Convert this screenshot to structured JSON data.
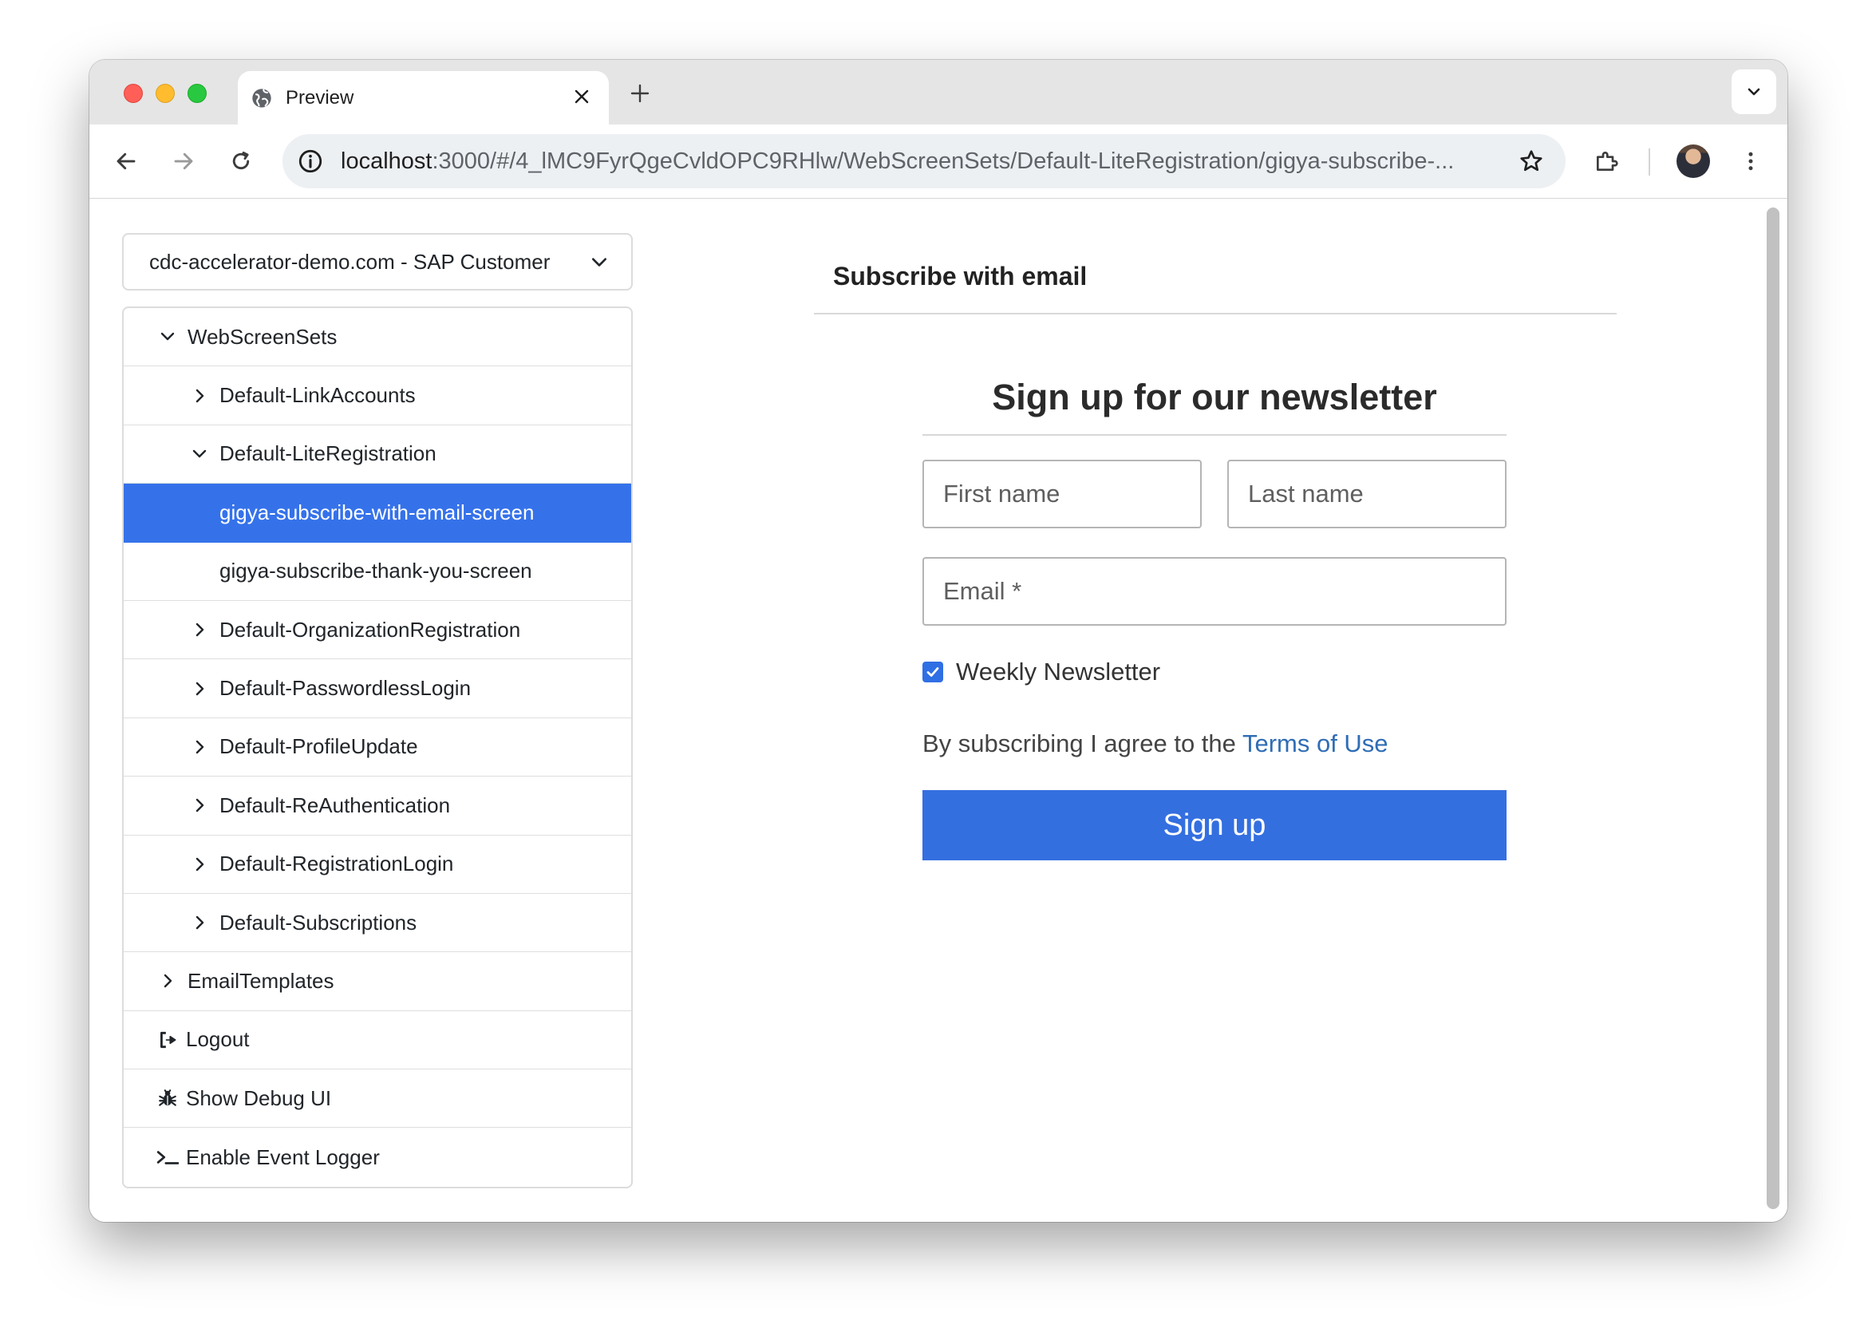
{
  "browser": {
    "tab_title": "Preview",
    "url_host": "localhost",
    "url_rest": ":3000/#/4_lMC9FyrQgeCvldOPC9RHlw/WebScreenSets/Default-LiteRegistration/gigya-subscribe-..."
  },
  "sidebar": {
    "site_selector": "cdc-accelerator-demo.com - SAP Customer",
    "items": [
      {
        "label": "WebScreenSets",
        "level": 0,
        "icon": "chevron-down-icon"
      },
      {
        "label": "Default-LinkAccounts",
        "level": 1,
        "icon": "chevron-right-icon"
      },
      {
        "label": "Default-LiteRegistration",
        "level": 1,
        "icon": "chevron-down-icon"
      },
      {
        "label": "gigya-subscribe-with-email-screen",
        "level": 2,
        "selected": true
      },
      {
        "label": "gigya-subscribe-thank-you-screen",
        "level": 2
      },
      {
        "label": "Default-OrganizationRegistration",
        "level": 1,
        "icon": "chevron-right-icon"
      },
      {
        "label": "Default-PasswordlessLogin",
        "level": 1,
        "icon": "chevron-right-icon"
      },
      {
        "label": "Default-ProfileUpdate",
        "level": 1,
        "icon": "chevron-right-icon"
      },
      {
        "label": "Default-ReAuthentication",
        "level": 1,
        "icon": "chevron-right-icon"
      },
      {
        "label": "Default-RegistrationLogin",
        "level": 1,
        "icon": "chevron-right-icon"
      },
      {
        "label": "Default-Subscriptions",
        "level": 1,
        "icon": "chevron-right-icon"
      },
      {
        "label": "EmailTemplates",
        "level": 0,
        "icon": "chevron-right-icon"
      },
      {
        "label": "Logout",
        "level": 0,
        "icon": "logout-icon"
      },
      {
        "label": "Show Debug UI",
        "level": 0,
        "icon": "bug-icon"
      },
      {
        "label": "Enable Event Logger",
        "level": 0,
        "icon": "terminal-icon"
      }
    ]
  },
  "preview": {
    "section_title": "Subscribe with email",
    "form_title": "Sign up for our newsletter",
    "first_name_placeholder": "First name",
    "last_name_placeholder": "Last name",
    "email_placeholder": "Email *",
    "newsletter_label": "Weekly Newsletter",
    "newsletter_checked": true,
    "agree_text": "By subscribing I agree to the ",
    "terms_link": "Terms of Use",
    "signup_label": "Sign up"
  },
  "colors": {
    "accent": "#3572ea",
    "link": "#2f6db5",
    "button": "#346fe0"
  }
}
